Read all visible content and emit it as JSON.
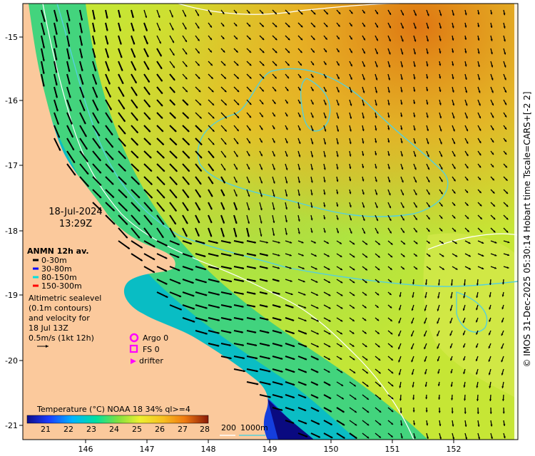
{
  "map": {
    "date": "18-Jul-2024",
    "time": "13:29Z",
    "side_credit": "© IMOS 31-Dec-2025 05:30:14 Hobart time Tscale=CARS+[-2 2]",
    "x_ticks": [
      "146",
      "147",
      "148",
      "149",
      "150",
      "151",
      "152"
    ],
    "y_ticks": [
      "-15",
      "-16",
      "-17",
      "-18",
      "-19",
      "-20",
      "-21"
    ],
    "anmn": {
      "title": "ANMN 12h av.",
      "items": [
        {
          "label": "0-30m",
          "color": "#000000"
        },
        {
          "label": "30-80m",
          "color": "#0000ff"
        },
        {
          "label": "80-150m",
          "color": "#00e0e0"
        },
        {
          "label": "150-300m",
          "color": "#ff0000"
        }
      ]
    },
    "altimetry": {
      "lines": [
        "Altimetric sealevel",
        "(0.1m contours)",
        "and velocity for",
        "18 Jul 13Z",
        "0.5m/s (1kt 12h)"
      ]
    },
    "obs": [
      {
        "label": "Argo 0",
        "color": "#ff00ff"
      },
      {
        "label": "FS 0",
        "color": "#ff00ff"
      },
      {
        "label": "drifter",
        "color": "#ff00ff"
      }
    ],
    "colorbar": {
      "title": "Temperature (°C) NOAA 18 34% ql>=4",
      "ticks": [
        "21",
        "22",
        "23",
        "24",
        "25",
        "26",
        "27",
        "28"
      ]
    },
    "isobaths": {
      "label_200": "200",
      "label_1000": "1000m"
    },
    "colors": {
      "land": "#fbc99c",
      "iso200": "#ffffff",
      "iso1000": "#5fd0d8",
      "arrow": "#000000"
    }
  }
}
